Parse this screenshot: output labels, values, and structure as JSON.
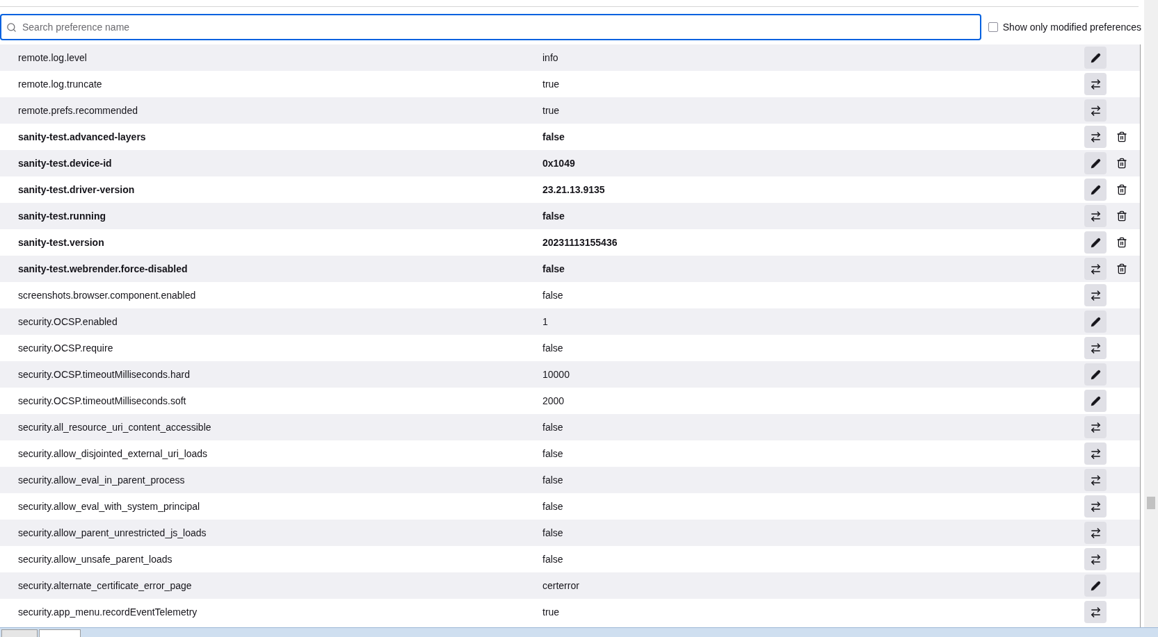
{
  "search": {
    "placeholder": "Search preference name"
  },
  "filter": {
    "label": "Show only modified preferences",
    "checked": false
  },
  "preferences": [
    {
      "name": "remote.log.level",
      "value": "info",
      "modified": false,
      "kind": "edit"
    },
    {
      "name": "remote.log.truncate",
      "value": "true",
      "modified": false,
      "kind": "toggle"
    },
    {
      "name": "remote.prefs.recommended",
      "value": "true",
      "modified": false,
      "kind": "toggle"
    },
    {
      "name": "sanity-test.advanced-layers",
      "value": "false",
      "modified": true,
      "kind": "toggle"
    },
    {
      "name": "sanity-test.device-id",
      "value": "0x1049",
      "modified": true,
      "kind": "edit"
    },
    {
      "name": "sanity-test.driver-version",
      "value": "23.21.13.9135",
      "modified": true,
      "kind": "edit"
    },
    {
      "name": "sanity-test.running",
      "value": "false",
      "modified": true,
      "kind": "toggle"
    },
    {
      "name": "sanity-test.version",
      "value": "20231113155436",
      "modified": true,
      "kind": "edit"
    },
    {
      "name": "sanity-test.webrender.force-disabled",
      "value": "false",
      "modified": true,
      "kind": "toggle"
    },
    {
      "name": "screenshots.browser.component.enabled",
      "value": "false",
      "modified": false,
      "kind": "toggle"
    },
    {
      "name": "security.OCSP.enabled",
      "value": "1",
      "modified": false,
      "kind": "edit"
    },
    {
      "name": "security.OCSP.require",
      "value": "false",
      "modified": false,
      "kind": "toggle"
    },
    {
      "name": "security.OCSP.timeoutMilliseconds.hard",
      "value": "10000",
      "modified": false,
      "kind": "edit"
    },
    {
      "name": "security.OCSP.timeoutMilliseconds.soft",
      "value": "2000",
      "modified": false,
      "kind": "edit"
    },
    {
      "name": "security.all_resource_uri_content_accessible",
      "value": "false",
      "modified": false,
      "kind": "toggle"
    },
    {
      "name": "security.allow_disjointed_external_uri_loads",
      "value": "false",
      "modified": false,
      "kind": "toggle"
    },
    {
      "name": "security.allow_eval_in_parent_process",
      "value": "false",
      "modified": false,
      "kind": "toggle"
    },
    {
      "name": "security.allow_eval_with_system_principal",
      "value": "false",
      "modified": false,
      "kind": "toggle"
    },
    {
      "name": "security.allow_parent_unrestricted_js_loads",
      "value": "false",
      "modified": false,
      "kind": "toggle"
    },
    {
      "name": "security.allow_unsafe_parent_loads",
      "value": "false",
      "modified": false,
      "kind": "toggle"
    },
    {
      "name": "security.alternate_certificate_error_page",
      "value": "certerror",
      "modified": false,
      "kind": "edit"
    },
    {
      "name": "security.app_menu.recordEventTelemetry",
      "value": "true",
      "modified": false,
      "kind": "toggle"
    }
  ]
}
